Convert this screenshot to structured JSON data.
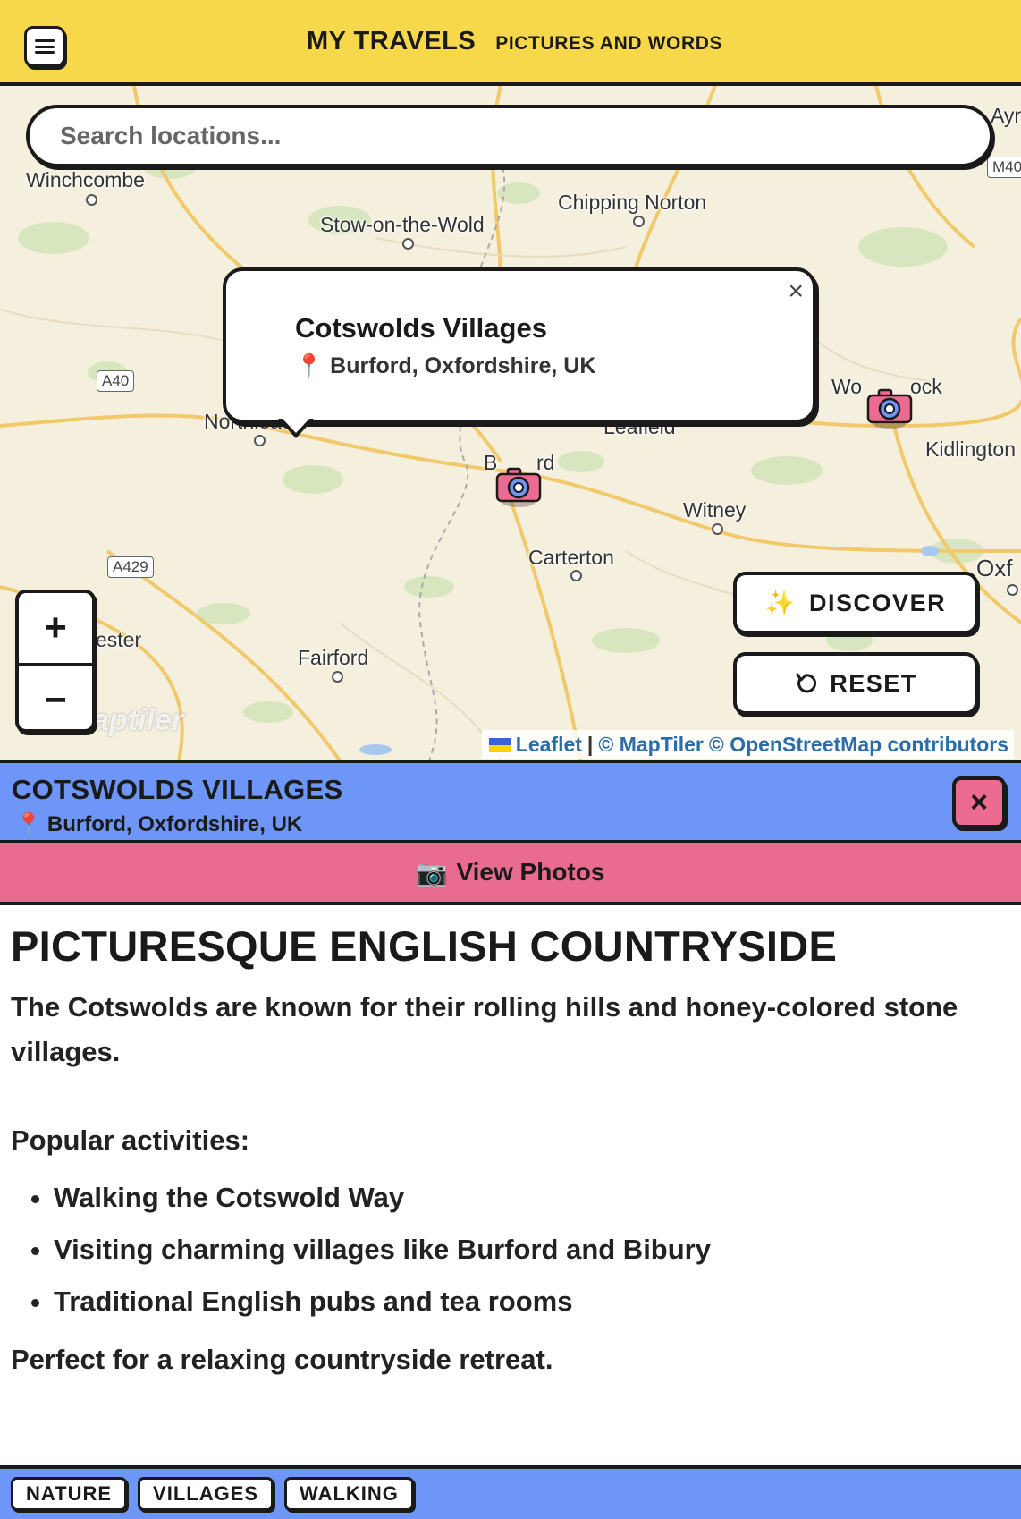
{
  "header": {
    "menu_icon": "hamburger-menu-icon",
    "title": "MY TRAVELS",
    "subtitle": "PICTURES AND WORDS",
    "color": "#f6d84a"
  },
  "map": {
    "search_placeholder": "Search locations...",
    "places": [
      "Winchcombe",
      "Chipping Norton",
      "Stow-on-the-Wold",
      "Northleach",
      "Leafield",
      "Kidlington",
      "Witney",
      "Carterton",
      "Fairford",
      "Wo",
      "ock",
      "B",
      "rd",
      "ester",
      "Ayr",
      "Oxf"
    ],
    "road_labels": [
      "A40",
      "A429",
      "M40"
    ],
    "popup": {
      "title": "Cotswolds Villages",
      "location_icon": "pin-icon",
      "location": "Burford, Oxfordshire, UK",
      "close_symbol": "×"
    },
    "markers": [
      "camera-marker-burford",
      "camera-marker-woodstock"
    ],
    "zoom_in": "+",
    "zoom_out": "−",
    "discover_label": "DISCOVER",
    "discover_icon": "sparkles-icon",
    "reset_label": "RESET",
    "reset_icon": "rotate-icon",
    "attribution": {
      "leaflet": "Leaflet",
      "separator": "|",
      "maptiler": "© MapTiler",
      "osm": "© OpenStreetMap contributors"
    },
    "logo": "aptiler"
  },
  "info": {
    "title": "COTSWOLDS VILLAGES",
    "location": "Burford, Oxfordshire, UK",
    "close_symbol": "×",
    "bar_color": "#6e95f8",
    "view_photos_label": "View Photos",
    "view_photos_icon": "camera-icon",
    "photos_color": "#ea6b90"
  },
  "content": {
    "heading": "PICTURESQUE ENGLISH COUNTRYSIDE",
    "intro": "The Cotswolds are known for their rolling hills and honey-colored stone villages.",
    "activities_label": "Popular activities:",
    "activities": [
      "Walking the Cotswold Way",
      "Visiting charming villages like Burford and Bibury",
      "Traditional English pubs and tea rooms"
    ],
    "closing": "Perfect for a relaxing countryside retreat."
  },
  "tags": [
    "NATURE",
    "VILLAGES",
    "WALKING"
  ]
}
